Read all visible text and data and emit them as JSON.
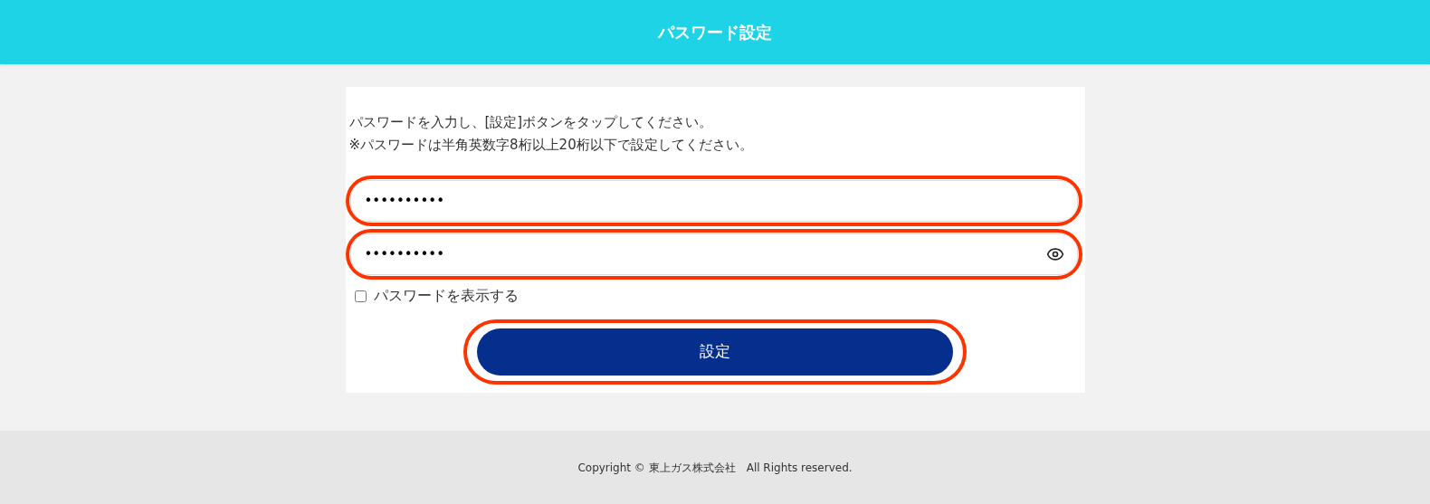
{
  "header": {
    "title": "パスワード設定"
  },
  "instructions": [
    "パスワードを入力し、[設定]ボタンをタップしてください。",
    "※パスワードは半角英数字8桁以上20桁以下で設定してください。"
  ],
  "fields": [
    {
      "value": "••••••••••",
      "highlighted": true,
      "reveal_toggle": false
    },
    {
      "value": "••••••••••",
      "highlighted": true,
      "reveal_toggle": true
    }
  ],
  "show_password": {
    "label": "パスワードを表示する",
    "checked": false
  },
  "submit": {
    "label": "設定",
    "highlighted": true
  },
  "footer": {
    "copyright": "Copyright © 東上ガス株式会社　All Rights reserved."
  }
}
